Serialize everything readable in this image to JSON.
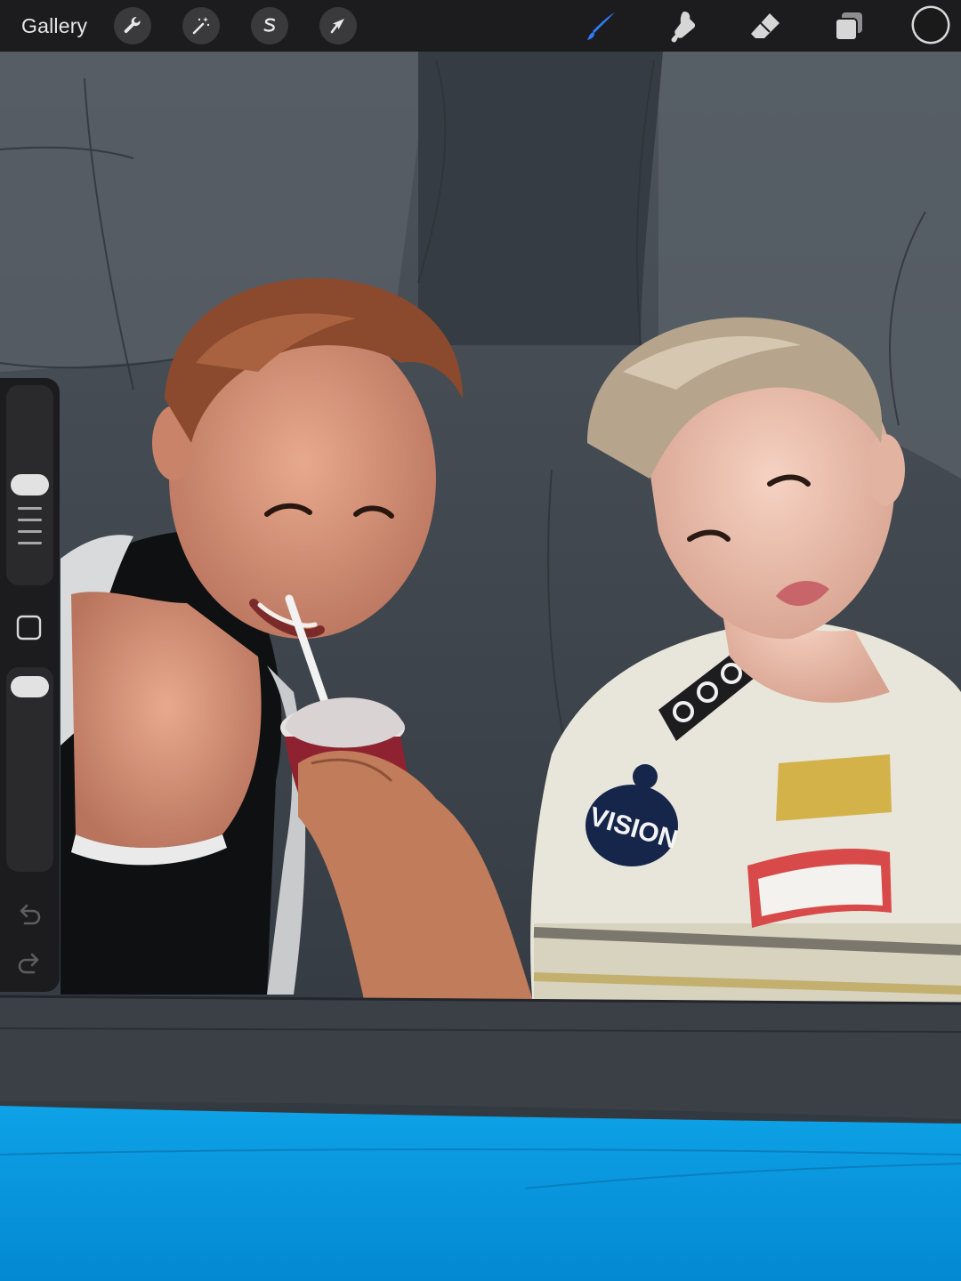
{
  "toolbar": {
    "gallery_label": "Gallery",
    "actions": [
      {
        "name": "actions-wrench",
        "icon": "wrench-icon"
      },
      {
        "name": "adjustments",
        "icon": "magic-wand-icon"
      },
      {
        "name": "selection",
        "icon": "selection-s-icon"
      },
      {
        "name": "transform",
        "icon": "arrow-cursor-icon"
      }
    ],
    "tools": [
      {
        "name": "brush",
        "icon": "brush-icon",
        "active": true
      },
      {
        "name": "smudge",
        "icon": "smudge-icon"
      },
      {
        "name": "eraser",
        "icon": "eraser-icon"
      },
      {
        "name": "layers",
        "icon": "layers-icon"
      }
    ],
    "active_color": "#1a1a1a",
    "accent": "#2f7bf5"
  },
  "canvas": {
    "artwork_text": "VISION"
  },
  "sidebar": {
    "brush_size_icon": "size-slider-thumb",
    "modify_button_icon": "square-icon",
    "opacity_icon": "opacity-slider-thumb",
    "undo_icon": "undo-icon",
    "redo_icon": "redo-icon"
  }
}
